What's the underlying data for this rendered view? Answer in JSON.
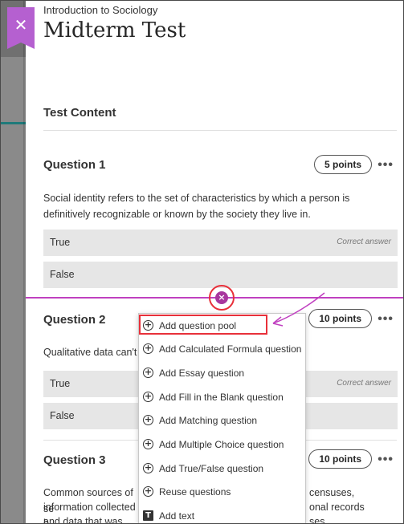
{
  "header": {
    "course": "Introduction to Sociology",
    "title": "Midterm Test",
    "close_symbol": "✕"
  },
  "content": {
    "section_title": "Test Content",
    "more_symbol": "•••"
  },
  "questions": [
    {
      "title": "Question 1",
      "points": "5 points",
      "text": "Social identity refers to the set of characteristics by which a person is definitively recognizable or known by the society they live in.",
      "answers": [
        {
          "label": "True",
          "status": "Correct answer"
        },
        {
          "label": "False",
          "status": ""
        }
      ]
    },
    {
      "title": "Question 2",
      "points": "10 points",
      "text": "Qualitative data can't b",
      "answers": [
        {
          "label": "True",
          "status": "Correct answer"
        },
        {
          "label": "False",
          "status": ""
        }
      ]
    },
    {
      "title": "Question 3",
      "points": "10 points",
      "text_left_1": "Common sources of se",
      "text_right_1": "censuses,",
      "text_left_2": "information collected b",
      "text_right_2": "onal records",
      "text_left_3": "and data that was orig",
      "text_right_3": "ses."
    }
  ],
  "insert": {
    "symbol": "×"
  },
  "menu": {
    "items": [
      {
        "label": "Add question pool",
        "icon": "plus-circle-icon",
        "glyph": "+"
      },
      {
        "label": "Add Calculated Formula question",
        "icon": "plus-circle-icon",
        "glyph": "+"
      },
      {
        "label": "Add Essay question",
        "icon": "plus-circle-icon",
        "glyph": "+"
      },
      {
        "label": "Add Fill in the Blank question",
        "icon": "plus-circle-icon",
        "glyph": "+"
      },
      {
        "label": "Add Matching question",
        "icon": "plus-circle-icon",
        "glyph": "+"
      },
      {
        "label": "Add Multiple Choice question",
        "icon": "plus-circle-icon",
        "glyph": "+"
      },
      {
        "label": "Add True/False question",
        "icon": "plus-circle-icon",
        "glyph": "+"
      },
      {
        "label": "Reuse questions",
        "icon": "plus-circle-icon",
        "glyph": "+"
      },
      {
        "label": "Add text",
        "icon": "text-icon",
        "glyph": "T"
      }
    ]
  },
  "colors": {
    "accent": "#b560d0",
    "insert_line": "#c040c0",
    "annotation_red": "#e8303a",
    "answer_bg": "#e6e6e6"
  }
}
